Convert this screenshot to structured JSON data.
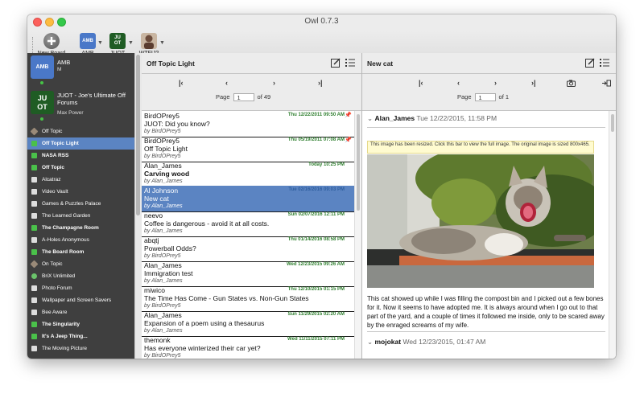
{
  "window": {
    "title": "Owl 0.7.3"
  },
  "toolbar": {
    "new_board_label": "New Board",
    "accounts": [
      {
        "label": "AMB",
        "badge": "AMB",
        "color": "#4a78c8"
      },
      {
        "label": "JUOT",
        "badge": "JU\nOT",
        "color": "#1f5c24"
      },
      {
        "label": "WTFIJ?",
        "badge": "",
        "color": "#6b4b3b"
      }
    ]
  },
  "sidebar": {
    "account1": {
      "name": "AMB",
      "sub": "M"
    },
    "account2": {
      "name": "JUOT - Joe's Ultimate Off Forums",
      "sub": "Max Power",
      "logo_text": "JU\nOT"
    },
    "forums": [
      {
        "label": "Off Topic",
        "icon": "tag-icon",
        "color": "#9a8a78",
        "bold": false,
        "selected": false
      },
      {
        "label": "Off Topic Light",
        "icon": "comment-icon",
        "color": "#4ac14a",
        "bold": true,
        "selected": true
      },
      {
        "label": "NASA RSS",
        "icon": "comment-icon",
        "color": "#4ac14a",
        "bold": true,
        "selected": false
      },
      {
        "label": "Off Topic",
        "icon": "comment-icon",
        "color": "#4ac14a",
        "bold": true,
        "selected": false
      },
      {
        "label": "Alcatraz",
        "icon": "comment-icon",
        "color": "#dddddd",
        "bold": false,
        "selected": false
      },
      {
        "label": "Video Vault",
        "icon": "comment-icon",
        "color": "#dddddd",
        "bold": false,
        "selected": false
      },
      {
        "label": "Games & Puzzles Palace",
        "icon": "comment-icon",
        "color": "#dddddd",
        "bold": false,
        "selected": false
      },
      {
        "label": "The Learned Garden",
        "icon": "comment-icon",
        "color": "#dddddd",
        "bold": false,
        "selected": false
      },
      {
        "label": "The Champagne Room",
        "icon": "comment-icon",
        "color": "#4ac14a",
        "bold": true,
        "selected": false
      },
      {
        "label": "A-Holes Anonymous",
        "icon": "comment-icon",
        "color": "#dddddd",
        "bold": false,
        "selected": false
      },
      {
        "label": "The Board Room",
        "icon": "comment-icon",
        "color": "#4ac14a",
        "bold": true,
        "selected": false
      },
      {
        "label": "On Topic",
        "icon": "tag-icon",
        "color": "#9a8a78",
        "bold": false,
        "selected": false
      },
      {
        "label": "BriX Unlimited",
        "icon": "globe-icon",
        "color": "#6bc46b",
        "bold": false,
        "selected": false
      },
      {
        "label": "Photo Forum",
        "icon": "comment-icon",
        "color": "#dddddd",
        "bold": false,
        "selected": false
      },
      {
        "label": "Wallpaper and Screen Savers",
        "icon": "comment-icon",
        "color": "#dddddd",
        "bold": false,
        "selected": false
      },
      {
        "label": "Bee Aware",
        "icon": "comment-icon",
        "color": "#dddddd",
        "bold": false,
        "selected": false
      },
      {
        "label": "The Singularity",
        "icon": "comment-icon",
        "color": "#4ac14a",
        "bold": true,
        "selected": false
      },
      {
        "label": "It's A Jeep Thing...",
        "icon": "comment-icon",
        "color": "#4ac14a",
        "bold": true,
        "selected": false
      },
      {
        "label": "The Moving Picture",
        "icon": "comment-icon",
        "color": "#dddddd",
        "bold": false,
        "selected": false
      }
    ]
  },
  "threads": {
    "title": "Off Topic Light",
    "page_label": "Page",
    "page": "1",
    "of_label": "of",
    "total": "49",
    "rows": [
      {
        "author": "BirdOPrey5",
        "date": "Thu 12/22/2011 09:50 AM",
        "subject": "JUOT: Did you know?",
        "by": "by BirdOPrey5",
        "bold": false,
        "selected": false,
        "pinned": true
      },
      {
        "author": "BirdOPrey5",
        "date": "Thu 05/19/2011 07:08 AM",
        "subject": "Off Topic Light",
        "by": "by BirdOPrey5",
        "bold": false,
        "selected": false,
        "pinned": true
      },
      {
        "author": "Alan_James",
        "date": "Today 10:25 PM",
        "subject": "Carving wood",
        "by": "by Alan_James",
        "bold": true,
        "selected": false,
        "pinned": false
      },
      {
        "author": "Al Johnson",
        "date": "Tue 02/16/2016 09:03 PM",
        "subject": "New cat",
        "by": "by Alan_James",
        "bold": false,
        "selected": true,
        "pinned": false
      },
      {
        "author": "neevo",
        "date": "Sun 02/07/2016 12:11 PM",
        "subject": "Coffee is dangerous - avoid it at all costs.",
        "by": "by Alan_James",
        "bold": false,
        "selected": false,
        "pinned": false
      },
      {
        "author": "abqtj",
        "date": "Thu 01/14/2016 08:58 PM",
        "subject": "Powerball Odds?",
        "by": "by BirdOPrey5",
        "bold": false,
        "selected": false,
        "pinned": false
      },
      {
        "author": "Alan_James",
        "date": "Wed 12/23/2015 09:26 AM",
        "subject": "Immigration test",
        "by": "by Alan_James",
        "bold": false,
        "selected": false,
        "pinned": false
      },
      {
        "author": "miwico",
        "date": "Thu 12/10/2015 01:15 PM",
        "subject": "The Time Has Come - Gun States vs. Non-Gun States",
        "by": "by BirdOPrey5",
        "bold": false,
        "selected": false,
        "pinned": false
      },
      {
        "author": "Alan_James",
        "date": "Sun 11/29/2015 02:20 AM",
        "subject": "Expansion of a poem using a thesaurus",
        "by": "by Alan_James",
        "bold": false,
        "selected": false,
        "pinned": false
      },
      {
        "author": "themonk",
        "date": "Wed 11/11/2015 07:11 PM",
        "subject": "Has everyone winterized their car yet?",
        "by": "by BirdOPrey5",
        "bold": false,
        "selected": false,
        "pinned": false
      }
    ]
  },
  "post": {
    "title": "New cat",
    "page_label": "Page",
    "page": "1",
    "of_label": "of",
    "total": "1",
    "first_author": "Alan_James",
    "first_date": "Tue 12/22/2015, 11:58 PM",
    "resize_notice": "This image has been resized. Click this bar to view the full image. The original image is sized 800x465.",
    "body": "This cat showed up while I was filling the compost bin and I picked out a few bones for it. Now it seems to have adopted me. It is always around when I go out to that part of the yard, and a couple of times it followed me inside, only to be scared away by the enraged screams of my wife.",
    "second_author": "mojokat",
    "second_date": "Wed 12/23/2015, 01:47 AM"
  },
  "nav_glyphs": {
    "first": "|‹",
    "prev": "‹",
    "next": "›",
    "last": "›|"
  }
}
